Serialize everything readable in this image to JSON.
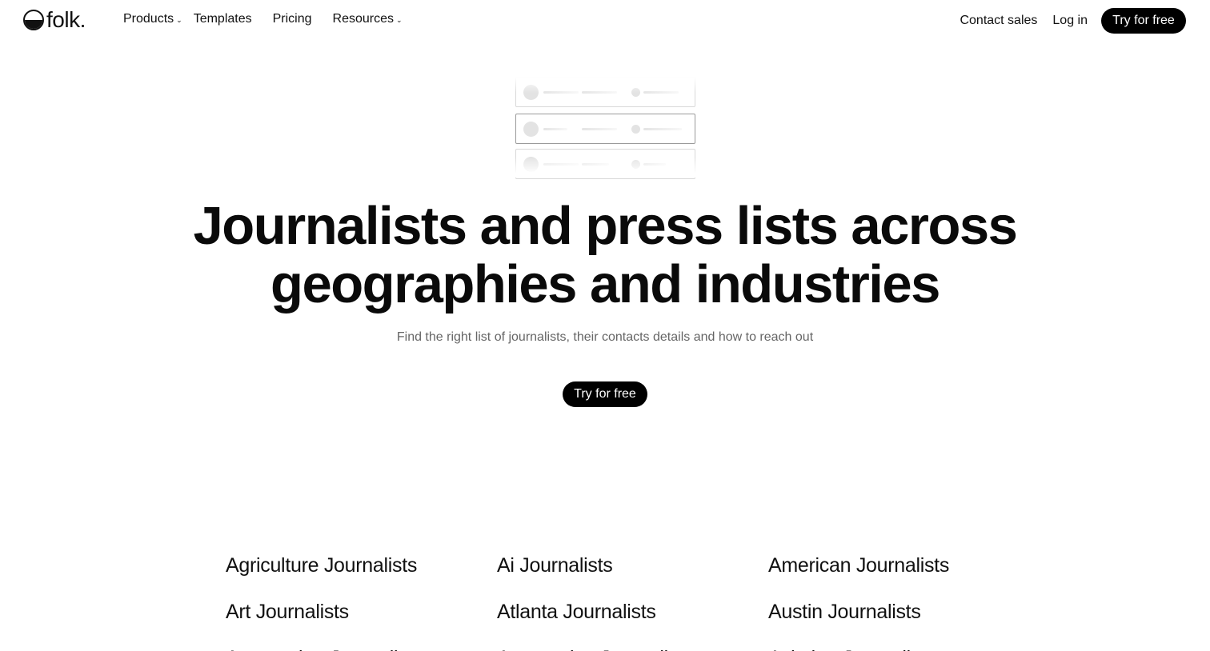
{
  "nav": {
    "logo_text": "folk.",
    "links": [
      {
        "label": "Products",
        "has_dropdown": true
      },
      {
        "label": "Templates",
        "has_dropdown": false
      },
      {
        "label": "Pricing",
        "has_dropdown": false
      },
      {
        "label": "Resources",
        "has_dropdown": true
      }
    ],
    "contact_sales": "Contact sales",
    "login": "Log in",
    "cta": "Try for free"
  },
  "hero": {
    "title_line1": "Journalists and press lists across",
    "title_line2": "geographies and industries",
    "subtitle": "Find the right list of journalists, their contacts details and how to reach out",
    "cta": "Try for free"
  },
  "journalist_lists": [
    "Agriculture Journalists",
    "Ai Journalists",
    "American Journalists",
    "Art Journalists",
    "Atlanta Journalists",
    "Austin Journalists",
    "Automation Journalists",
    "Automotive Journalists",
    "Aviation Journalists"
  ],
  "colors": {
    "text": "#111111",
    "subtitle": "#666666",
    "button_bg": "#000000",
    "button_text": "#ffffff"
  }
}
